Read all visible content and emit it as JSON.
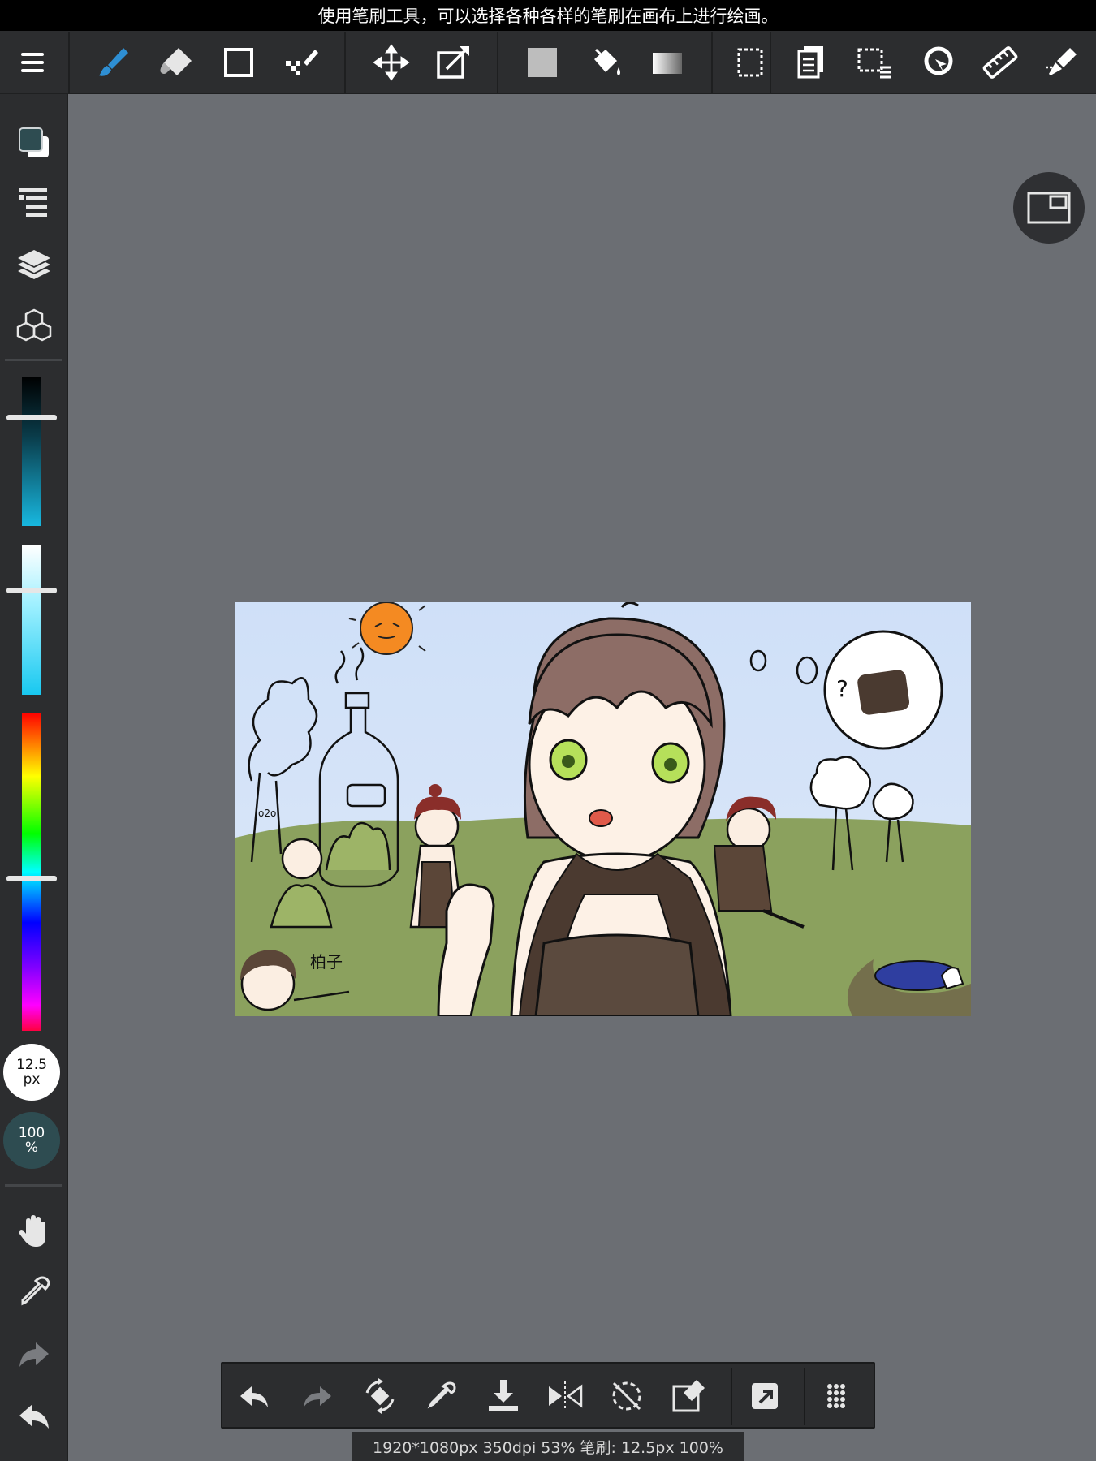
{
  "hint_bar": {
    "text": "使用笔刷工具，可以选择各种各样的笔刷在画布上进行绘画。"
  },
  "top_toolbar": {
    "tools": [
      "menu-icon",
      "brush-icon",
      "eraser-icon",
      "rectangle-icon",
      "dot-brush-icon",
      "move-icon",
      "transform-icon",
      "fill-color-icon",
      "bucket-icon",
      "gradient-icon",
      "selection-icon",
      "layer-copy-icon",
      "select-layer-icon",
      "lasso-icon",
      "ruler-icon",
      "snap-icon"
    ],
    "active_tool": "brush-icon",
    "accent_color": "#2e8fd4"
  },
  "left_sidebar": {
    "color_primary": "#2e4c51",
    "color_secondary": "#ffffff",
    "brush_size": {
      "value": "12.5",
      "unit": "px"
    },
    "brush_opacity": {
      "value": "100",
      "unit": "%"
    },
    "sliders": {
      "brightness_level": 0.27,
      "saturation_level": 0.3,
      "hue_level": 0.52
    }
  },
  "bottom_toolbar": {
    "tools": [
      "undo-icon",
      "redo-icon",
      "rotate-canvas-icon",
      "eyedropper-icon",
      "save-icon",
      "flip-icon",
      "reset-rotation-icon",
      "clear-icon",
      "share-icon",
      "more-icon"
    ]
  },
  "status_bar": {
    "text": "1920*1080px 350dpi 53% 笔刷: 12.5px 100%"
  },
  "artwork": {
    "thought_text": "?",
    "caption_text": "柏子",
    "small_text": "o2o"
  }
}
